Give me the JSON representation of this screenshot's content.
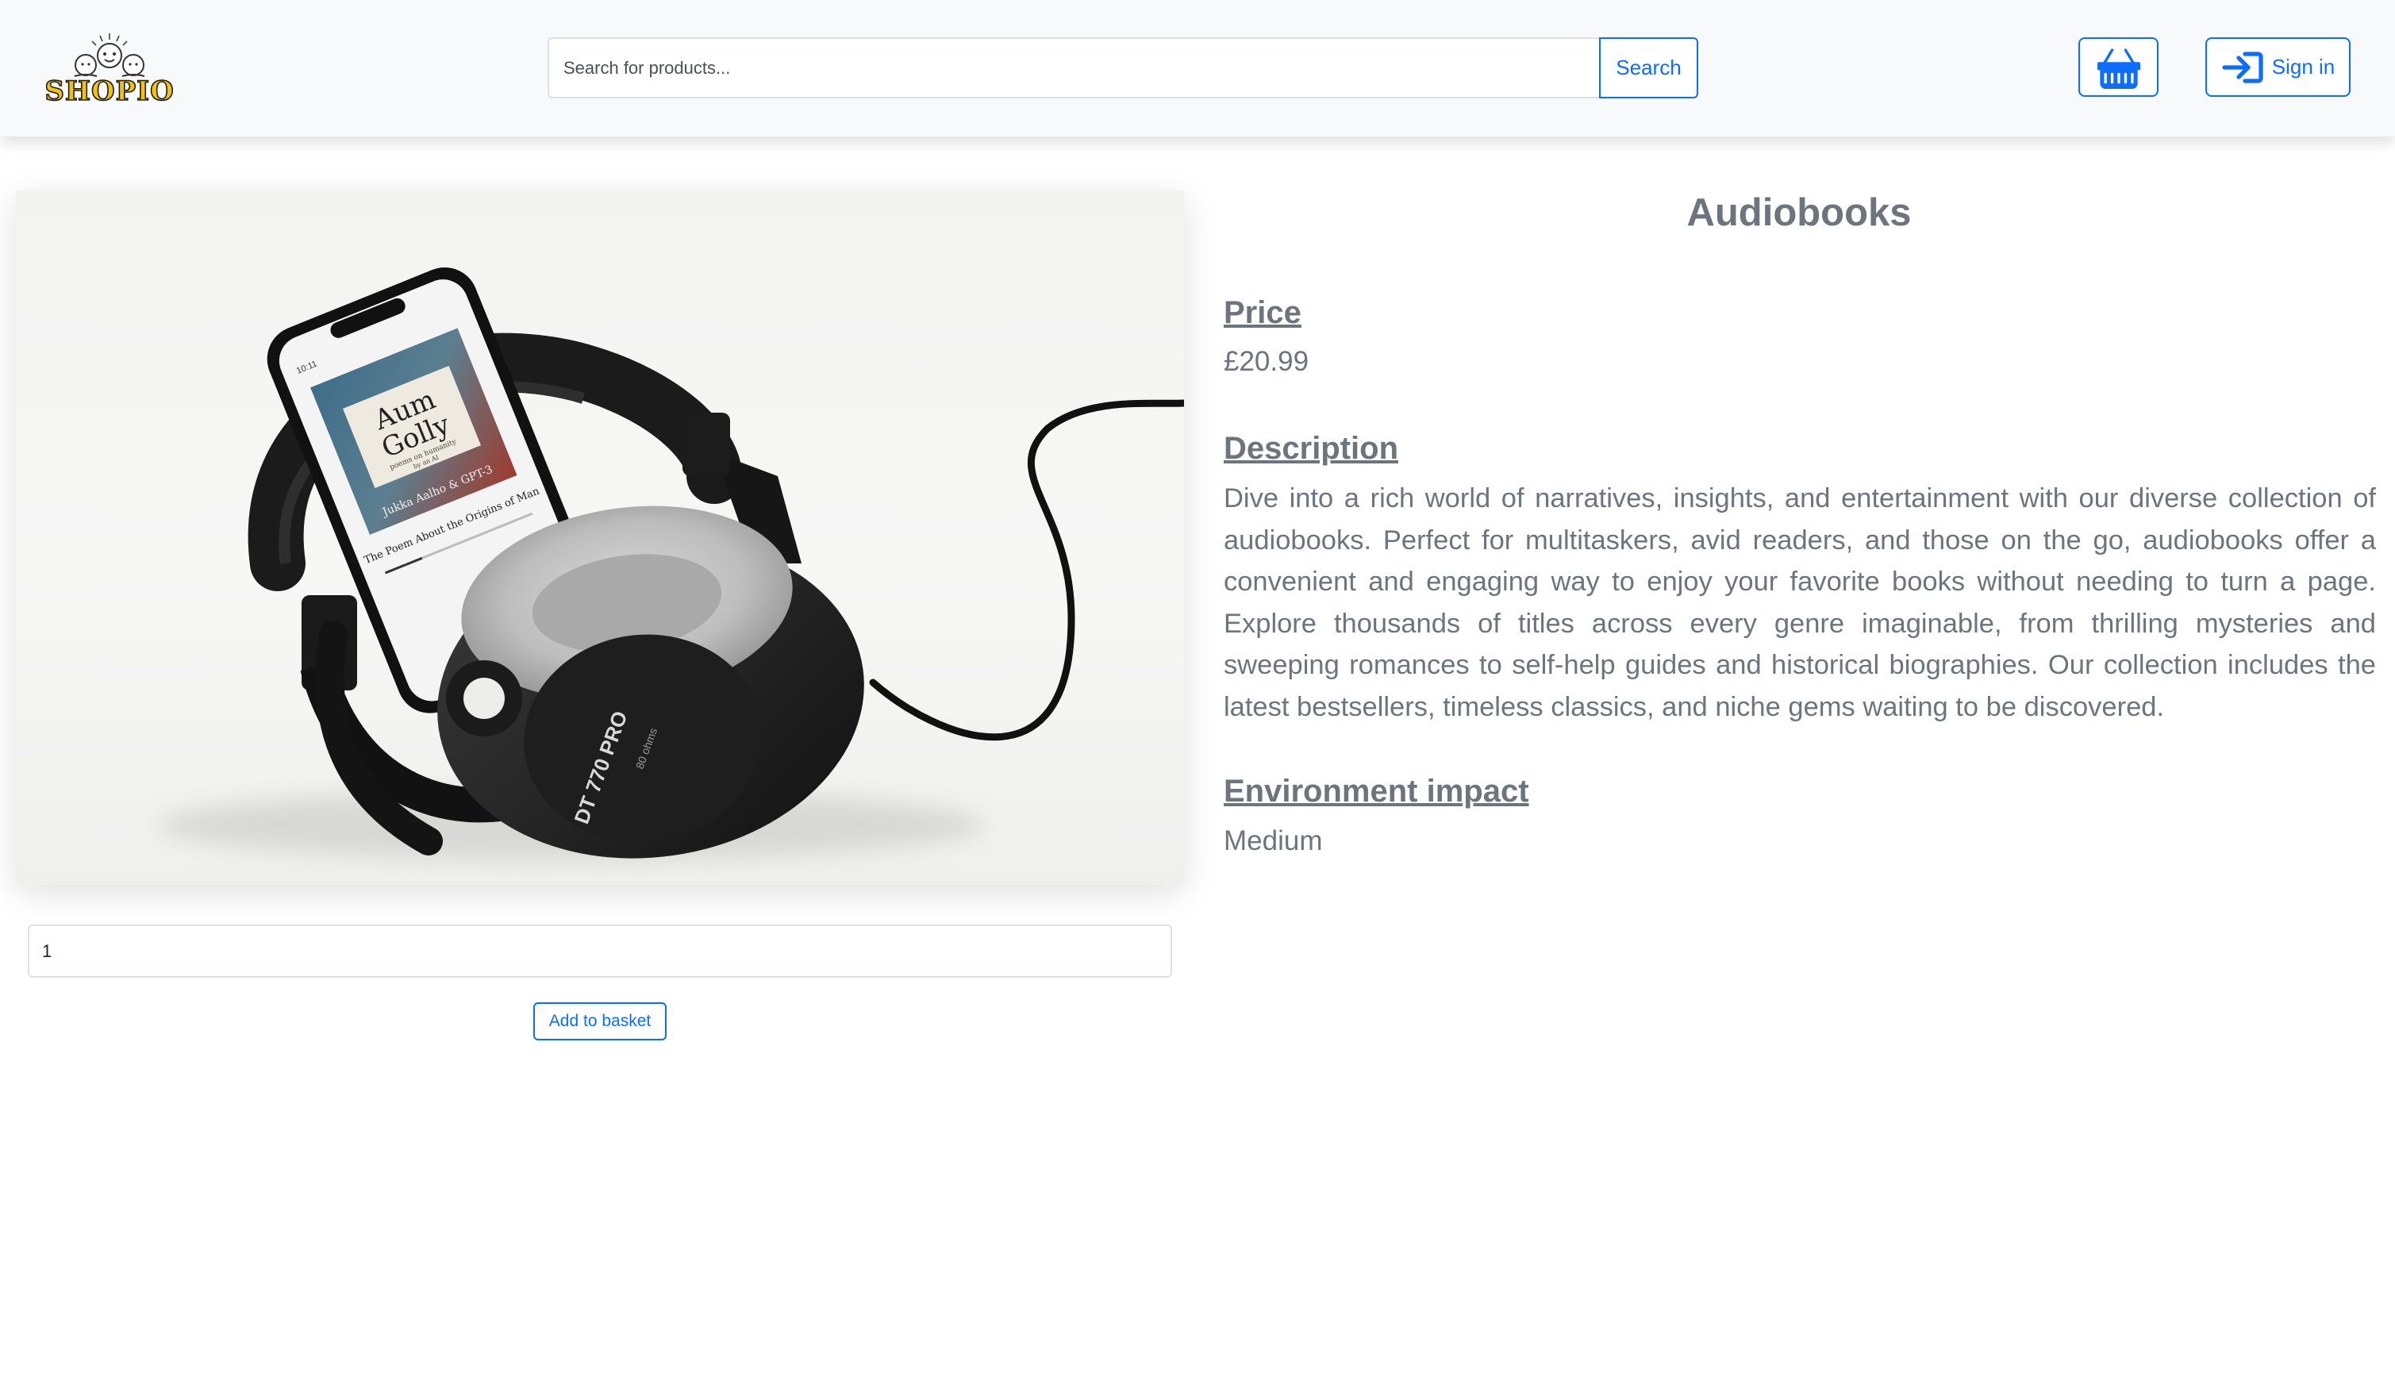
{
  "header": {
    "logo_text": "SHOPIO",
    "search": {
      "placeholder": "Search for products...",
      "value": "",
      "button_label": "Search"
    },
    "basket_icon": "basket-icon",
    "signin": {
      "icon": "sign-in-arrow-icon",
      "label": "Sign in"
    }
  },
  "product": {
    "title": "Audiobooks",
    "image": {
      "subject": "smartphone-on-headphones",
      "phone_screen": {
        "cover_title_line1": "Aum",
        "cover_title_line2": "Golly",
        "cover_subtitle": "poems on humanity",
        "cover_byline": "by an AI",
        "cover_author": "Jukka Aalho & GPT-3",
        "track_title": "The Poem About the Origins of Man",
        "status_time": "10:11"
      },
      "headphones_brand": "DT 770 PRO",
      "headphones_model": "80 ohms"
    },
    "price": {
      "label": "Price",
      "value": "£20.99"
    },
    "description": {
      "label": "Description",
      "text": "Dive into a rich world of narratives, insights, and entertainment with our diverse collection of audiobooks. Perfect for multitaskers, avid readers, and those on the go, audiobooks offer a convenient and engaging way to enjoy your favorite books without needing to turn a page. Explore thousands of titles across every genre imaginable, from thrilling mysteries and sweeping romances to self-help guides and historical biographies. Our collection includes the latest bestsellers, timeless classics, and niche gems waiting to be discovered."
    },
    "environment": {
      "label": "Environment impact",
      "value": "Medium"
    }
  },
  "purchase": {
    "quantity": "1",
    "add_label": "Add to basket"
  },
  "colors": {
    "accent": "#0d6efd",
    "text_muted": "#6c757d",
    "navbar_bg": "#f8f9fa"
  }
}
